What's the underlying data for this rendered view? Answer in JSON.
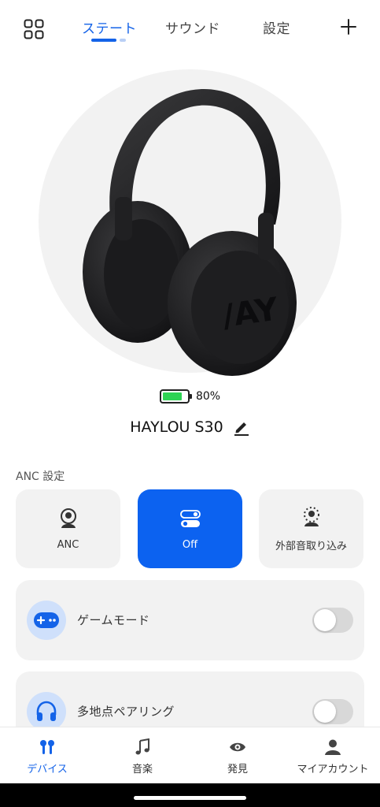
{
  "header": {
    "tabs": [
      {
        "label": "ステート",
        "active": true
      },
      {
        "label": "サウンド",
        "active": false
      },
      {
        "label": "設定",
        "active": false
      }
    ],
    "icons": {
      "menu": "grid-icon",
      "add": "plus-icon"
    },
    "accent_color": "#1463e8"
  },
  "device": {
    "battery_label": "80%",
    "battery_level": 0.8,
    "battery_color": "#2ed354",
    "name": "HAYLOU S30"
  },
  "anc": {
    "section_title": "ANC 設定",
    "modes": [
      {
        "label": "ANC",
        "icon": "anc-person-icon",
        "active": false
      },
      {
        "label": "Off",
        "icon": "toggle-off-icon",
        "active": true
      },
      {
        "label": "外部音取り込み",
        "icon": "ambient-person-icon",
        "active": false
      }
    ],
    "active_color": "#0c62f0"
  },
  "toggles": [
    {
      "label": "ゲームモード",
      "icon": "gamepad-icon",
      "enabled": false
    },
    {
      "label": "多地点ペアリング",
      "icon": "headphones-icon",
      "enabled": false
    }
  ],
  "nav": {
    "items": [
      {
        "label": "デバイス",
        "icon": "earbuds-icon",
        "active": true
      },
      {
        "label": "音楽",
        "icon": "music-note-icon",
        "active": false
      },
      {
        "label": "発見",
        "icon": "eye-icon",
        "active": false
      },
      {
        "label": "マイアカウント",
        "icon": "person-icon",
        "active": false
      }
    ]
  }
}
